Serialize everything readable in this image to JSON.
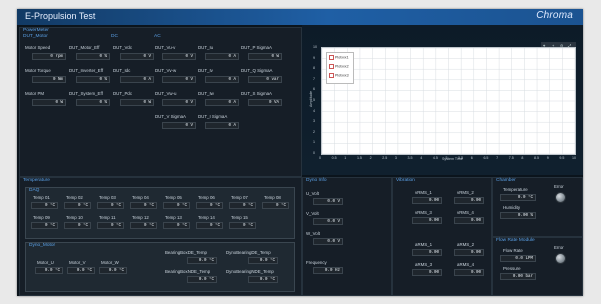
{
  "window": {
    "title": "E-Propulsion Test",
    "brand": "Chroma"
  },
  "power_analyzer": {
    "title": "PowerMeter",
    "sections": [
      "DUT_Motor",
      "DC",
      "AC"
    ],
    "fields": [
      {
        "label": "Motor Speed",
        "value": "0 rpm"
      },
      {
        "label": "DUT_Motor_Eff",
        "value": "0 %"
      },
      {
        "label": "DUT_Vdc",
        "value": "0 V"
      },
      {
        "label": "DUT_Vu-v",
        "value": "0 V"
      },
      {
        "label": "DUT_Iu",
        "value": "0 A"
      },
      {
        "label": "DUT_P SigmaA",
        "value": "0 W"
      },
      {
        "label": "Motor Torque",
        "value": "0 Nm"
      },
      {
        "label": "DUT_Inverter_Eff",
        "value": "0 %"
      },
      {
        "label": "DUT_Idc",
        "value": "0 A"
      },
      {
        "label": "DUT_Vv-w",
        "value": "0 V"
      },
      {
        "label": "DUT_Iv",
        "value": "0 A"
      },
      {
        "label": "DUT_Q SigmaA",
        "value": "0 var"
      },
      {
        "label": "Motor PM",
        "value": "0 W"
      },
      {
        "label": "DUT_System_Eff",
        "value": "0 %"
      },
      {
        "label": "DUT_Pdc",
        "value": "0 W"
      },
      {
        "label": "DUT_Vw-u",
        "value": "0 V"
      },
      {
        "label": "DUT_Iw",
        "value": "0 A"
      },
      {
        "label": "DUT_S SigmaA",
        "value": "0 VA"
      },
      {
        "label": "DUT_V SigmaA",
        "value": "0 V"
      },
      {
        "label": "DUT_I SigmaA",
        "value": "0 A"
      }
    ]
  },
  "chart_data": {
    "type": "line",
    "series": [
      {
        "name": "Plotxxx1",
        "values": []
      },
      {
        "name": "Plotxxx2",
        "values": []
      },
      {
        "name": "Plotxxx3",
        "values": []
      }
    ],
    "xlabel": "System Time",
    "ylabel": "Amplitude",
    "xlim": [
      0,
      10
    ],
    "ylim": [
      0,
      10
    ],
    "xticks": [
      "0",
      "0.5",
      "1",
      "1.5",
      "2",
      "2.5",
      "3",
      "3.5",
      "4",
      "4.5",
      "5",
      "5.5",
      "6",
      "6.5",
      "7",
      "7.5",
      "8",
      "8.5",
      "9",
      "9.5",
      "10"
    ],
    "yticks": [
      "10",
      "9",
      "8",
      "7",
      "6",
      "5",
      "4",
      "3",
      "2",
      "1",
      "0"
    ],
    "grid": true,
    "legend": "top-left",
    "colors": {
      "plot_bg": "#ffffff",
      "grid": "#d8dde2"
    }
  },
  "plot_toolbar": [
    "⌖",
    "+",
    "⊖",
    "⤢"
  ],
  "temperature": {
    "title": "Temperature",
    "daq_title": "DAQ",
    "temps_row1": [
      {
        "label": "Temp 01",
        "value": "0 °C"
      },
      {
        "label": "Temp 02",
        "value": "0 °C"
      },
      {
        "label": "Temp 03",
        "value": "0 °C"
      },
      {
        "label": "Temp 04",
        "value": "0 °C"
      },
      {
        "label": "Temp 05",
        "value": "0 °C"
      },
      {
        "label": "Temp 06",
        "value": "0 °C"
      },
      {
        "label": "Temp 07",
        "value": "0 °C"
      },
      {
        "label": "Temp 08",
        "value": "0 °C"
      }
    ],
    "temps_row2": [
      {
        "label": "Temp 09",
        "value": "0 °C"
      },
      {
        "label": "Temp 10",
        "value": "0 °C"
      },
      {
        "label": "Temp 11",
        "value": "0 °C"
      },
      {
        "label": "Temp 12",
        "value": "0 °C"
      },
      {
        "label": "Temp 13",
        "value": "0 °C"
      },
      {
        "label": "Temp 14",
        "value": "0 °C"
      },
      {
        "label": "Temp 15",
        "value": "0 °C"
      }
    ],
    "dyno_motor_title": "Dyno_Motor",
    "dyno_fields": [
      {
        "label": "Motor_U",
        "value": "0.0 °C"
      },
      {
        "label": "Motor_V",
        "value": "0.0 °C"
      },
      {
        "label": "Motor_W",
        "value": "0.0 °C"
      }
    ],
    "bearing_fields": [
      {
        "label": "BearingBoxDE_Temp",
        "value": "0.0 °C"
      },
      {
        "label": "DynoBearingDE_Temp",
        "value": "0.0 °C"
      },
      {
        "label": "BearingBoxNDE_Temp",
        "value": "0.0 °C"
      },
      {
        "label": "DynoBearingNDE_Temp",
        "value": "0.0 °C"
      }
    ]
  },
  "dyno_info": {
    "title": "Dyno Info",
    "fields": [
      {
        "label": "U_Volt",
        "value": "0.0 V"
      },
      {
        "label": "V_Volt",
        "value": "0.0 V"
      },
      {
        "label": "W_Volt",
        "value": "0.0 V"
      },
      {
        "label": "Frequency",
        "value": "0.0 Hz"
      }
    ]
  },
  "vibration": {
    "title": "Vibration",
    "fields": [
      {
        "label": "vRMS_1",
        "value": "0.00"
      },
      {
        "label": "vRMS_2",
        "value": "0.00"
      },
      {
        "label": "vRMS_3",
        "value": "0.00"
      },
      {
        "label": "vRMS_4",
        "value": "0.00"
      },
      {
        "label": "aRMS_1",
        "value": "0.00"
      },
      {
        "label": "aRMS_2",
        "value": "0.00"
      },
      {
        "label": "aRMS_3",
        "value": "0.00"
      },
      {
        "label": "aRMS_4",
        "value": "0.00"
      }
    ]
  },
  "chamber": {
    "title": "Chamber",
    "temperature_label": "Temperature",
    "temperature_value": "0.0 °C",
    "humidity_label": "Humidity",
    "humidity_value": "0.00 %",
    "error_label": "Error"
  },
  "flow_rate": {
    "title": "Flow Rate Module",
    "flow_label": "Flow Rate",
    "flow_value": "0.0 LPM",
    "pressure_label": "Pressure",
    "pressure_value": "0.00 bar",
    "error_label": "Error"
  }
}
